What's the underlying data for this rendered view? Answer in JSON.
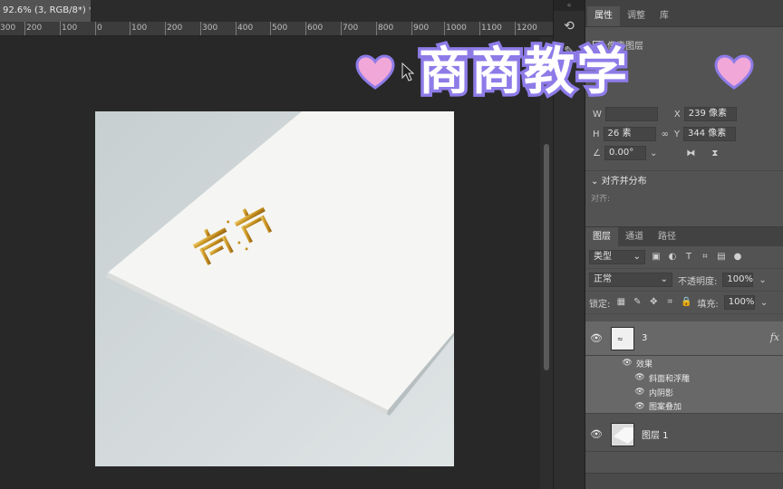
{
  "document": {
    "tab_title": "92.6% (3, RGB/8*) *"
  },
  "ruler": {
    "ticks": [
      "300",
      "200",
      "100",
      "0",
      "100",
      "200",
      "300",
      "400",
      "500",
      "600",
      "700",
      "800",
      "900",
      "1000",
      "1100",
      "1200"
    ]
  },
  "panel_tabs": {
    "properties": "属性",
    "adjustments": "调整",
    "libraries": "库"
  },
  "properties": {
    "title_label": "像素图层",
    "w_label": "W",
    "w_value": "",
    "x_label": "X",
    "x_value": "239 像素",
    "h_label": "H",
    "h_value": "26",
    "h_unit": "素",
    "y_label": "Y",
    "y_value": "344 像素",
    "angle_value": "0.00°",
    "align_section": "对齐并分布",
    "align_sub": "对齐:"
  },
  "layers_tabs": {
    "layers": "图层",
    "channels": "通道",
    "paths": "路径"
  },
  "layers_controls": {
    "filter_type": "类型",
    "blend_mode": "正常",
    "opacity_label": "不透明度:",
    "opacity_value": "100%",
    "lock_label": "锁定:",
    "fill_label": "填充:",
    "fill_value": "100%"
  },
  "layers": [
    {
      "name": "3",
      "fx": "fx",
      "effects_label": "效果",
      "effects": [
        "斜面和浮雕",
        "内阴影",
        "图案叠加"
      ]
    },
    {
      "name": "图层 1"
    }
  ],
  "watermark": {
    "text": "商商教学"
  },
  "colors": {
    "panel_bg": "#535353",
    "canvas_bg": "#282828",
    "watermark_stroke": "#8e7be8",
    "heart_fill": "#f1a7d8",
    "gold": "#c8a033"
  }
}
